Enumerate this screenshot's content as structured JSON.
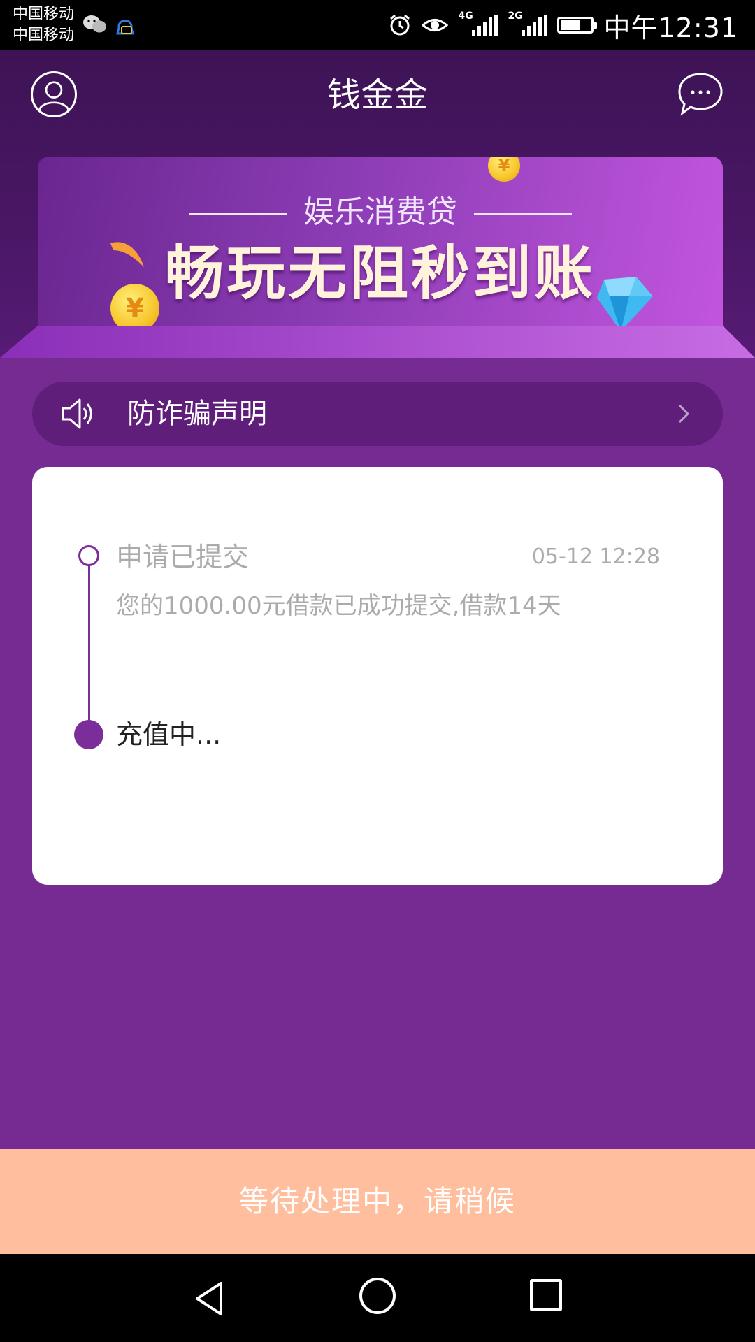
{
  "status_bar": {
    "carrier_1": "中国移动",
    "carrier_2": "中国移动",
    "time": "中午12:31",
    "network_1": "4G",
    "network_2": "2G",
    "icons": [
      "wechat-icon",
      "qq-icon",
      "alarm-icon",
      "eye-icon",
      "signal-icon",
      "battery-icon"
    ]
  },
  "header": {
    "title": "钱金金",
    "left_icon": "avatar-icon",
    "right_icon": "message-icon"
  },
  "banner": {
    "subtitle": "娱乐消费贷",
    "headline": "畅玩无阻秒到账",
    "coin_symbol": "¥"
  },
  "notice": {
    "label": "防诈骗声明",
    "icon": "speaker-icon"
  },
  "progress": {
    "steps": [
      {
        "title": "申请已提交",
        "time": "05-12 12:28",
        "description": "您的1000.00元借款已成功提交,借款14天",
        "state": "done"
      },
      {
        "title": "充值中...",
        "state": "current"
      }
    ]
  },
  "action": {
    "label": "等待处理中，请稍候"
  },
  "colors": {
    "primary": "#762B93",
    "header": "#3E1355",
    "accent_button": "#FFBE9E",
    "timeline": "#7B2E99"
  }
}
